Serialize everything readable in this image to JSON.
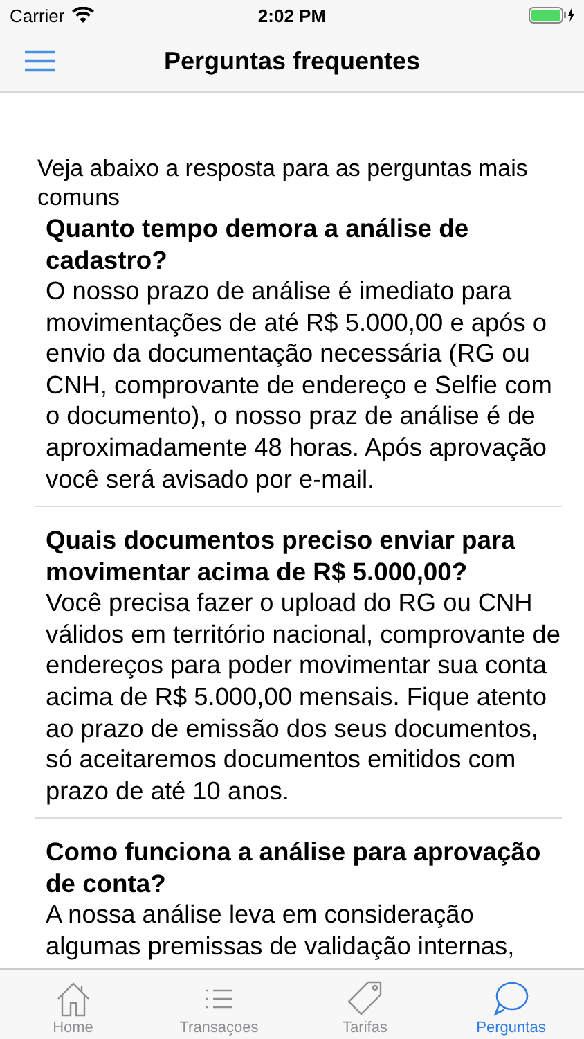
{
  "status_bar": {
    "carrier": "Carrier",
    "time": "2:02 PM"
  },
  "nav": {
    "title": "Perguntas frequentes"
  },
  "intro": "Veja abaixo a resposta para as perguntas mais comuns",
  "faqs": [
    {
      "question": "Quanto tempo demora a análise de cadastro?",
      "answer": "O nosso prazo de análise é imediato para movimentações de até R$ 5.000,00 e após o envio da documentação necessária (RG ou CNH, comprovante de endereço e Selfie com o documento), o nosso praz de análise é de aproximadamente 48 horas. Após aprovação você será avisado por e-mail."
    },
    {
      "question": "Quais documentos preciso enviar para movimentar acima de R$ 5.000,00?",
      "answer": "Você precisa fazer o upload do RG ou CNH válidos em território nacional, comprovante de endereços para poder movimentar sua conta acima de R$ 5.000,00 mensais. Fique atento ao prazo de emissão dos seus documentos, só aceitaremos documentos emitidos com prazo de até 10 anos."
    },
    {
      "question": "Como funciona a análise para aprovação de conta?",
      "answer": "A nossa análise leva em consideração algumas premissas de validação internas,"
    }
  ],
  "tabs": [
    {
      "label": "Home",
      "selected": false
    },
    {
      "label": "Transaçoes",
      "selected": false
    },
    {
      "label": "Tarifas",
      "selected": false
    },
    {
      "label": "Perguntas",
      "selected": true
    }
  ]
}
